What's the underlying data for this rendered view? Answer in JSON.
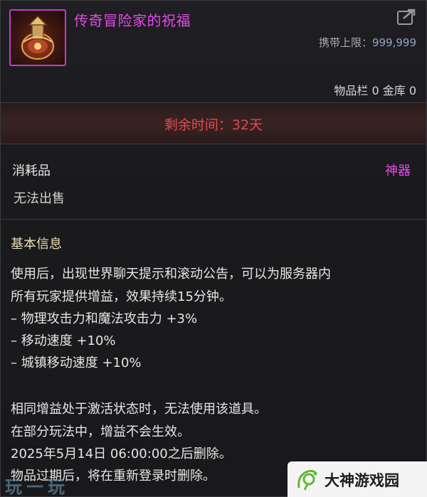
{
  "item": {
    "name": "传奇冒险家的祝福",
    "carry_limit_label": "携带上限：",
    "carry_limit_value": "999,999",
    "storage_text": "物品栏 0 金库 0",
    "remaining_time": "剩余时间：32天",
    "category": "消耗品",
    "rarity": "神器",
    "trade_status": "无法出售"
  },
  "basic_info": {
    "title": "基本信息",
    "lines": [
      "使用后，出现世界聊天提示和滚动公告，可以为服务器内",
      "所有玩家提供增益，效果持续15分钟。",
      "– 物理攻击力和魔法攻击力 +3%",
      "– 移动速度 +10%",
      "– 城镇移动速度 +10%"
    ],
    "notes": [
      "相同增益处于激活状态时，无法使用该道具。",
      "在部分玩法中，增益不会生效。",
      "2025年5月14日 06:00:00之后删除。",
      "物品过期后，将在重新登录时删除。"
    ]
  },
  "watermarks": {
    "left": "玩一玩",
    "right": "大神游戏园"
  },
  "colors": {
    "epic_name": "#e14be8",
    "time_warning": "#e0494a",
    "section_title": "#e8dcb2"
  },
  "icons": [
    "item-icon",
    "share-icon",
    "dashen-logo-icon"
  ]
}
